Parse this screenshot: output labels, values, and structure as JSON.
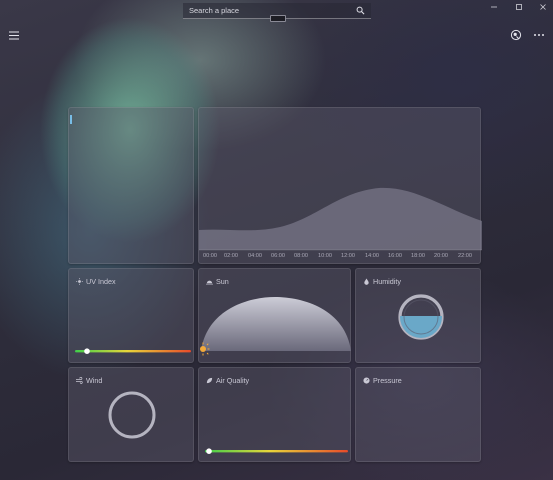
{
  "search": {
    "placeholder": "Search a place"
  },
  "toolbar": {
    "menu_icon": "hamburger-icon",
    "location_icon": "map-pin-icon",
    "more_icon": "more-icon"
  },
  "cards": {
    "uv": {
      "title": "UV Index",
      "icon": "sun-icon",
      "level": 0.12
    },
    "sun": {
      "title": "Sun",
      "icon": "sunrise-icon"
    },
    "humidity": {
      "title": "Humidity",
      "icon": "droplet-icon",
      "fill": 0.35
    },
    "wind": {
      "title": "Wind",
      "icon": "wind-icon"
    },
    "air": {
      "title": "Air Quality",
      "icon": "leaf-icon",
      "level": 0.04
    },
    "pressure": {
      "title": "Pressure",
      "icon": "gauge-icon"
    }
  },
  "forecast": {
    "times": [
      "00:00",
      "02:00",
      "04:00",
      "06:00",
      "08:00",
      "10:00",
      "12:00",
      "14:00",
      "16:00",
      "18:00",
      "20:00",
      "22:00"
    ]
  },
  "colors": {
    "accent": "#78bde6",
    "gradient": [
      "#3fcf4a",
      "#e8d63a",
      "#e84a2a"
    ]
  }
}
